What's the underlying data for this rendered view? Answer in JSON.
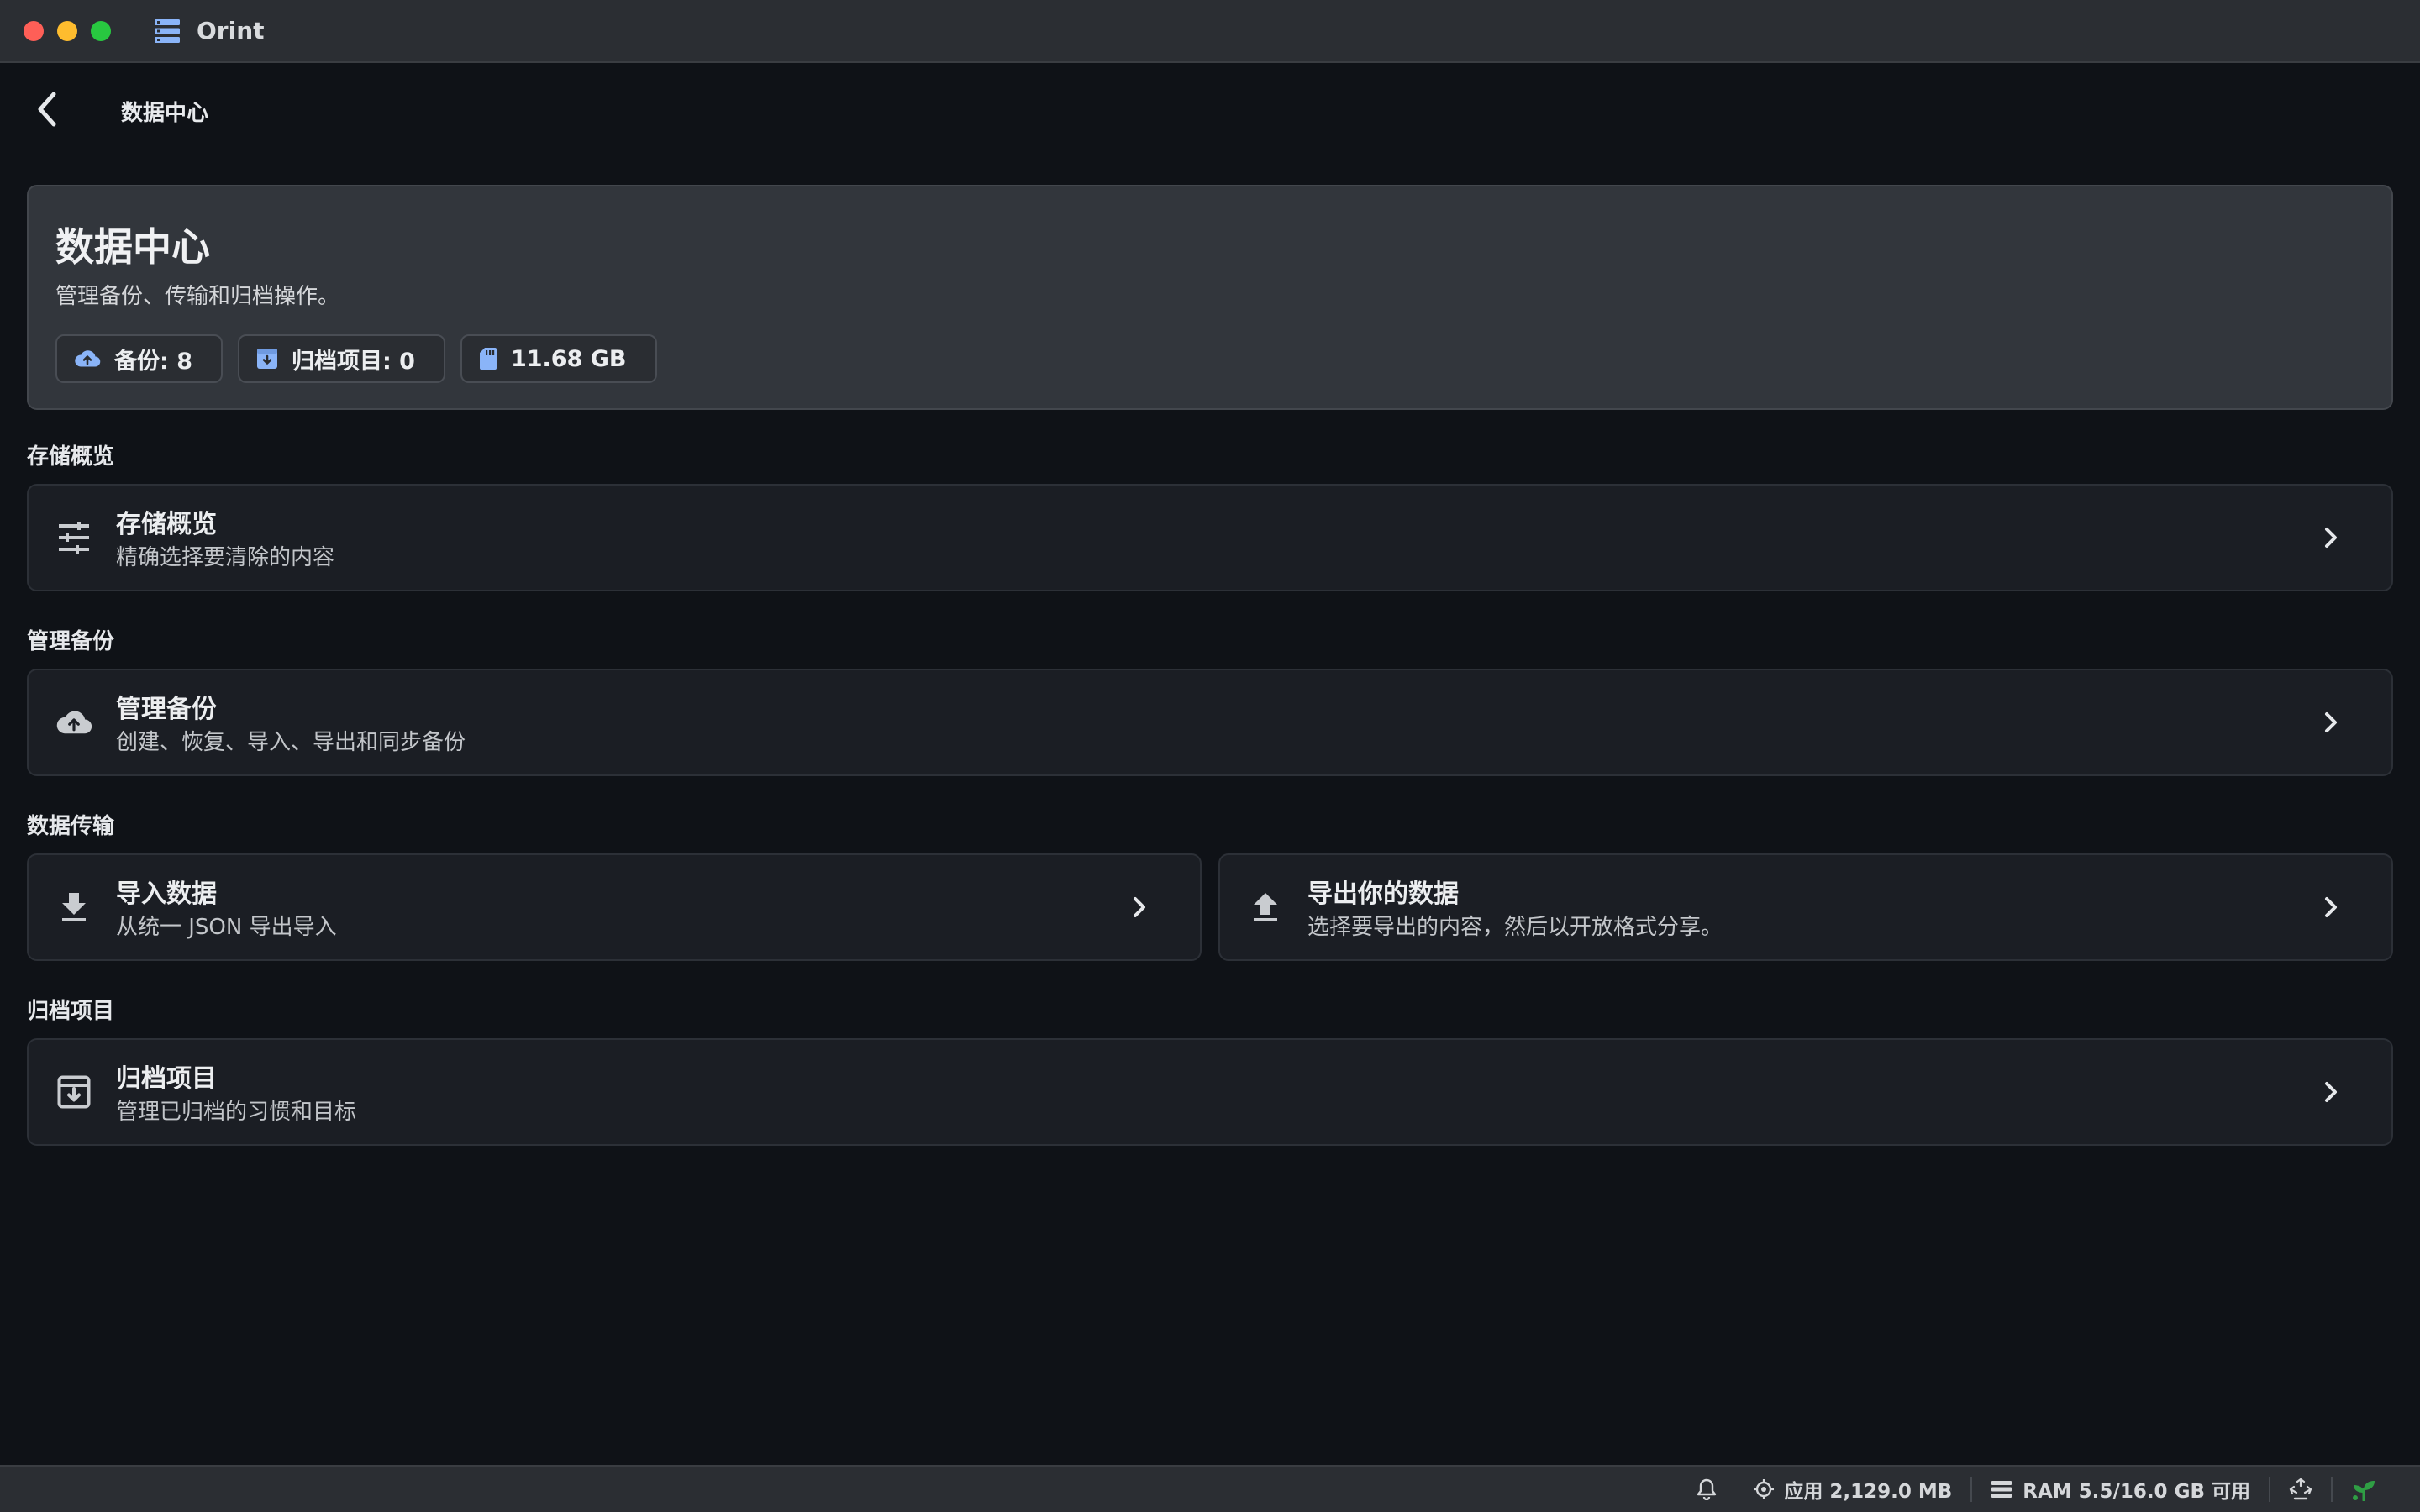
{
  "window": {
    "app_title": "Orint"
  },
  "nav": {
    "title": "数据中心"
  },
  "hero": {
    "title": "数据中心",
    "subtitle": "管理备份、传输和归档操作。",
    "chips": [
      {
        "icon": "cloud-upload-icon",
        "label": "备份: 8"
      },
      {
        "icon": "archive-icon",
        "label": "归档项目: 0"
      },
      {
        "icon": "sd-card-icon",
        "label": "11.68 GB"
      }
    ]
  },
  "sections": {
    "storage": {
      "label": "存储概览",
      "card": {
        "icon": "tune-icon",
        "title": "存储概览",
        "subtitle": "精确选择要清除的内容"
      }
    },
    "backup": {
      "label": "管理备份",
      "card": {
        "icon": "cloud-upload-icon",
        "title": "管理备份",
        "subtitle": "创建、恢复、导入、导出和同步备份"
      }
    },
    "transfer": {
      "label": "数据传输",
      "import": {
        "icon": "download-icon",
        "title": "导入数据",
        "subtitle": "从统一 JSON 导出导入"
      },
      "export": {
        "icon": "upload-icon",
        "title": "导出你的数据",
        "subtitle": "选择要导出的内容，然后以开放格式分享。"
      }
    },
    "archive": {
      "label": "归档项目",
      "card": {
        "icon": "archive-icon",
        "title": "归档项目",
        "subtitle": "管理已归档的习惯和目标"
      }
    }
  },
  "statusbar": {
    "app_memory": "应用 2,129.0 MB",
    "ram": "RAM 5.5/16.0 GB 可用"
  },
  "colors": {
    "background": "#0f1217",
    "card": "#1b1e24",
    "hero": "#32363c",
    "accent_blue": "#8ab4f8",
    "status_green": "#2f9e44"
  }
}
